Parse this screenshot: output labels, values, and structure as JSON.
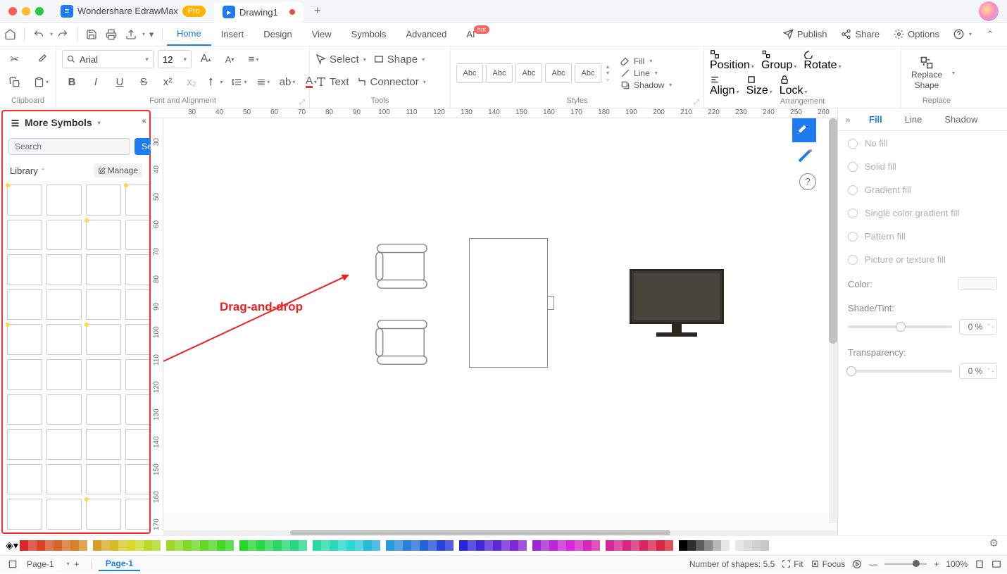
{
  "titlebar": {
    "app_name": "Wondershare EdrawMax",
    "pro": "Pro",
    "document": "Drawing1"
  },
  "menubar": {
    "items": [
      "Home",
      "Insert",
      "Design",
      "View",
      "Symbols",
      "Advanced",
      "AI"
    ],
    "hot": "hot",
    "right": {
      "publish": "Publish",
      "share": "Share",
      "options": "Options"
    }
  },
  "ribbon": {
    "clipboard": "Clipboard",
    "font_name": "Arial",
    "font_size": "12",
    "font_group": "Font and Alignment",
    "tools": {
      "label": "Tools",
      "select": "Select",
      "shape": "Shape",
      "text": "Text",
      "connector": "Connector"
    },
    "styles": {
      "label": "Styles",
      "sample": "Abc"
    },
    "style_cmds": {
      "fill": "Fill",
      "line": "Line",
      "shadow": "Shadow"
    },
    "arrangement": {
      "label": "Arrangement",
      "position": "Position",
      "group": "Group",
      "rotate": "Rotate",
      "align": "Align",
      "size": "Size",
      "lock": "Lock"
    },
    "replace": {
      "label": "Replace",
      "line1": "Replace",
      "line2": "Shape"
    }
  },
  "symbols_panel": {
    "title": "More Symbols",
    "search_ph": "Search",
    "search_btn": "Search",
    "library": "Library",
    "manage": "Manage"
  },
  "ruler_h": [
    "30",
    "40",
    "50",
    "60",
    "70",
    "80",
    "90",
    "100",
    "110",
    "120",
    "130",
    "140",
    "150",
    "160",
    "170",
    "180",
    "190",
    "200",
    "210",
    "220",
    "230",
    "240",
    "250",
    "260"
  ],
  "ruler_v": [
    "30",
    "40",
    "50",
    "60",
    "70",
    "80",
    "90",
    "100",
    "110",
    "120",
    "130",
    "140",
    "150",
    "160",
    "170"
  ],
  "annotation": "Drag-and-drop",
  "right_panel": {
    "tabs": [
      "Fill",
      "Line",
      "Shadow"
    ],
    "opts": [
      "No fill",
      "Solid fill",
      "Gradient fill",
      "Single color gradient fill",
      "Pattern fill",
      "Picture or texture fill"
    ],
    "color": "Color:",
    "shade": "Shade/Tint:",
    "transparency": "Transparency:",
    "pct": "0 %"
  },
  "statusbar": {
    "page": "Page-1",
    "page_tab": "Page-1",
    "shapes": "Number of shapes: 5.5",
    "fit": "Fit",
    "focus": "Focus",
    "zoom": "100%"
  }
}
